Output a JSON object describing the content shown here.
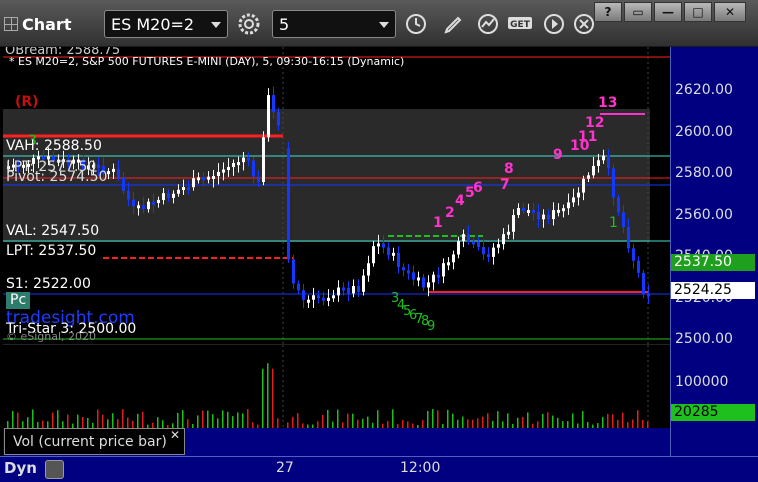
{
  "toolbar": {
    "app_title": "Chart",
    "symbol_value": "ES M20=2",
    "interval_value": "5",
    "window_buttons": [
      "?",
      "▭",
      "—",
      "□",
      "✕"
    ]
  },
  "chart": {
    "header_top": "OBream: 2588.75",
    "header_line": "* ES M20=2, S&P 500 FUTURES E-MINI (DAY), 5, 09:30-16:15 (Dynamic)",
    "r_marker": "(R)",
    "levels": {
      "vah": "VAH: 2588.50",
      "lpt_upper": "LPT: 2577.50",
      "pivot": "Pivot: 2574.50",
      "val": "VAL: 2547.50",
      "lpt": "LPT: 2537.50",
      "s1": "S1: 2522.00",
      "pc": "Pc",
      "tristar": "Tri-Star 3: 2500.00"
    },
    "watermark": "tradesight.com",
    "copyright": "© eSignal, 2020",
    "seq_magenta": [
      "1",
      "2",
      "4",
      "5",
      "6",
      "7",
      "8",
      "9",
      "10",
      "11",
      "12",
      "13"
    ],
    "seq_green_top": [
      "3",
      "1"
    ],
    "seq_green": [
      "3",
      "4",
      "5",
      "6",
      "7",
      "8",
      "9"
    ],
    "colors": {
      "magenta": "#ff33cc",
      "green": "#1ec01e",
      "blue": "#1438ff",
      "red": "#ff2020",
      "cyan": "#40e0d0"
    }
  },
  "price_axis": {
    "labels": [
      "2620.00",
      "2600.00",
      "2580.00",
      "2560.00",
      "2540.00",
      "2520.00",
      "2500.00"
    ],
    "last_price_tag": "2537.50",
    "current_price_tag": "2524.25"
  },
  "volume": {
    "label": "Vol (current price bar)",
    "close": "✕",
    "axis_label": "100000",
    "current_tag": "20285"
  },
  "time_axis": {
    "corner": "Dyn",
    "labels": [
      "27",
      "12:00"
    ]
  }
}
